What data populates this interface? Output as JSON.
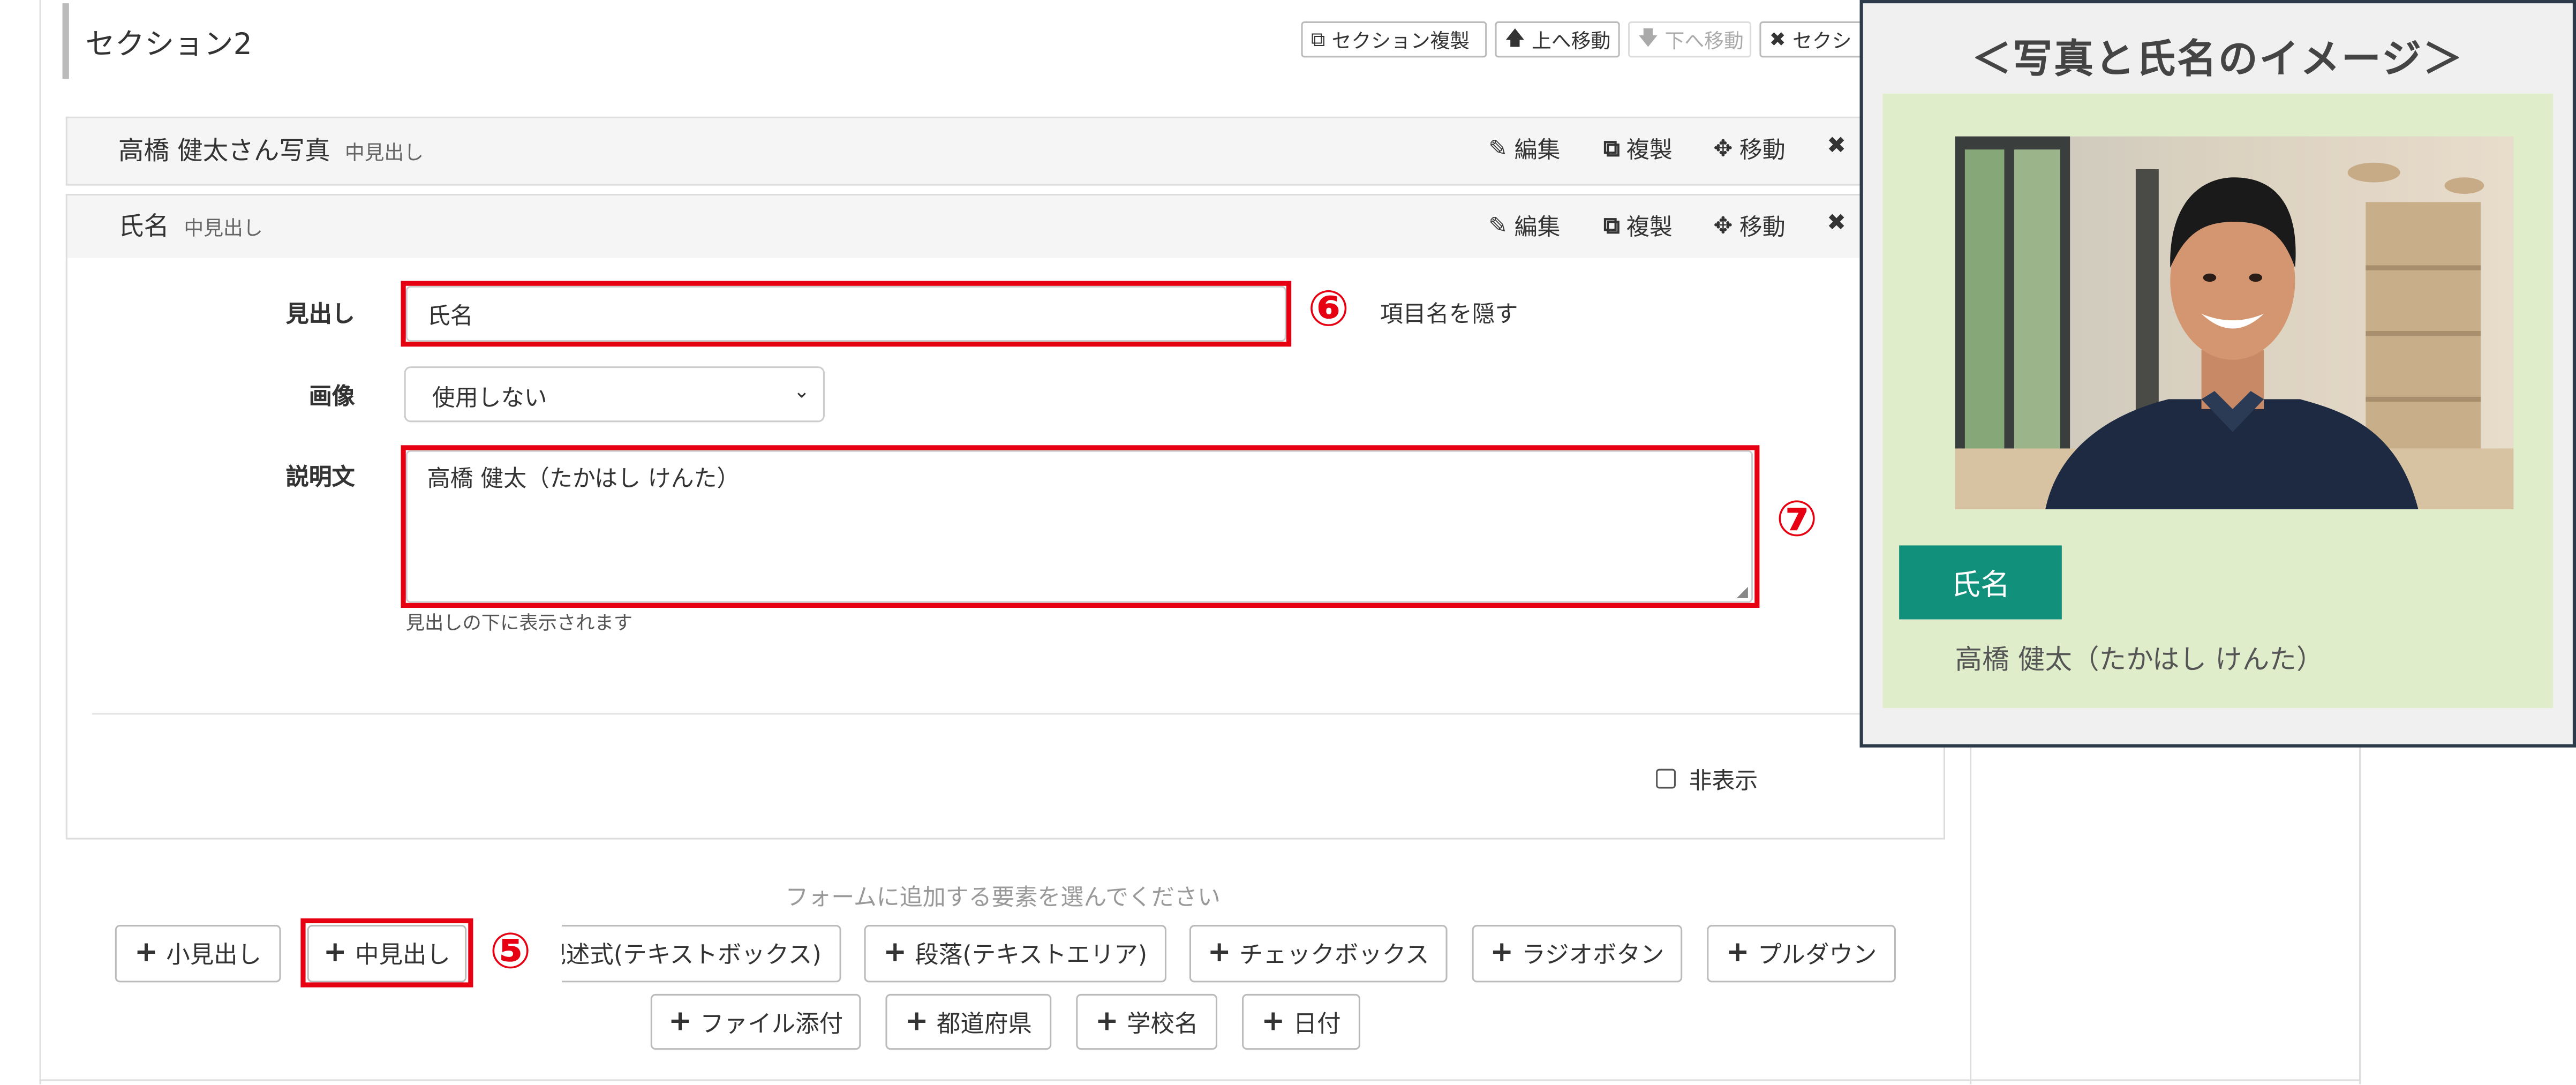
{
  "section": {
    "title": "セクション2",
    "buttons": [
      {
        "label": "セクション複製",
        "icon": "copy-icon"
      },
      {
        "label": "上へ移動",
        "icon": "arrow-up-icon"
      },
      {
        "label": "下へ移動",
        "icon": "arrow-down-icon"
      },
      {
        "label": "セクシ",
        "icon": "close-icon"
      }
    ]
  },
  "item1": {
    "title": "高橋 健太さん写真",
    "type": "中見出し",
    "actions": [
      "編集",
      "複製",
      "移動"
    ]
  },
  "item2": {
    "title": "氏名",
    "type": "中見出し",
    "actions": [
      "編集",
      "複製",
      "移動"
    ]
  },
  "form": {
    "heading_label": "見出し",
    "heading_value": "氏名",
    "hide_label_text": "項目名を隠す",
    "image_label": "画像",
    "image_selected": "使用しない",
    "desc_label": "説明文",
    "desc_value": "高橋 健太（たかはし けんた）",
    "desc_help": "見出しの下に表示されます",
    "hidden_checkbox_label": "非表示"
  },
  "add": {
    "prompt": "フォームに追加する要素を選んでください",
    "row1": [
      "小見出し",
      "中見出し",
      "記述式(テキストボックス)",
      "段落(テキストエリア)",
      "チェックボックス",
      "ラジオボタン",
      "プルダウン"
    ],
    "row2": [
      "ファイル添付",
      "都道府県",
      "学校名",
      "日付"
    ]
  },
  "annotations": {
    "n5": "⑤",
    "n6": "⑥",
    "n7": "⑦"
  },
  "preview": {
    "title": "＜写真と氏名のイメージ＞",
    "name_label": "氏名",
    "name_value": "高橋 健太（たかはし けんた）"
  },
  "colors": {
    "accent_red": "#e60012",
    "preview_bg": "#dfedcb",
    "name_badge": "#11907b",
    "preview_border": "#2d3a4a"
  }
}
